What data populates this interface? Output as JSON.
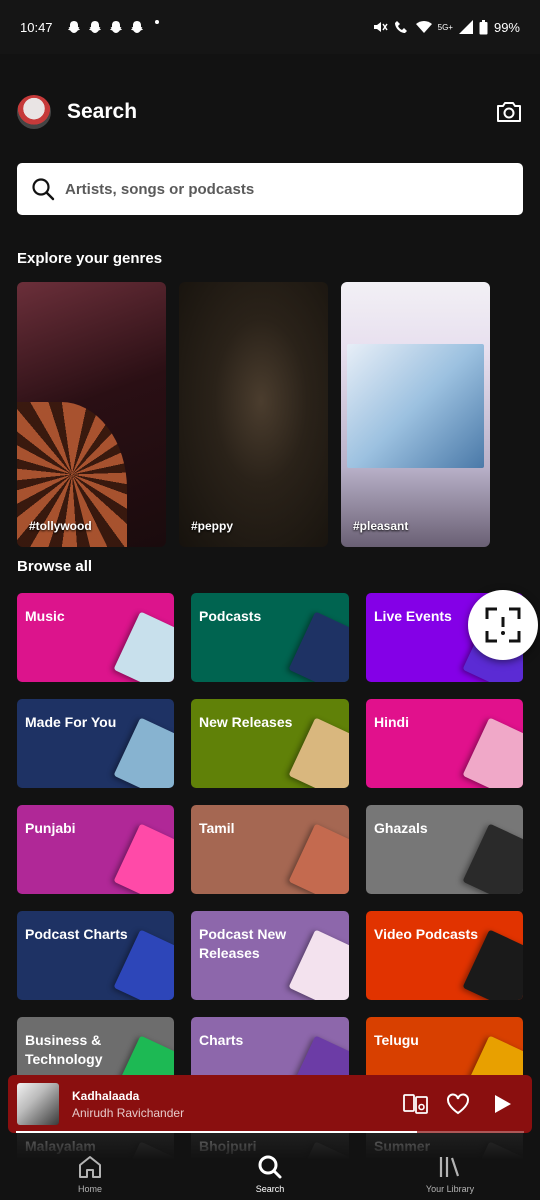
{
  "status_bar": {
    "time": "10:47",
    "network": "5G+",
    "battery": "99%",
    "notification_icons": [
      "snapchat-icon",
      "snapchat-icon",
      "snapchat-icon",
      "snapchat-icon"
    ]
  },
  "header": {
    "title": "Search"
  },
  "search": {
    "placeholder": "Artists, songs or podcasts"
  },
  "genres": {
    "title": "Explore your genres",
    "items": [
      {
        "label": "#tollywood"
      },
      {
        "label": "#peppy"
      },
      {
        "label": "#pleasant"
      }
    ]
  },
  "browse": {
    "title": "Browse all",
    "tiles": [
      {
        "label": "Music",
        "color": "#dc148c",
        "art": "#c8e0ec"
      },
      {
        "label": "Podcasts",
        "color": "#006450",
        "art": "#1e3264"
      },
      {
        "label": "Live Events",
        "color": "#8400e7",
        "art": "#5b2bd4"
      },
      {
        "label": "Made For You",
        "color": "#1e3264",
        "art": "#87b3d0"
      },
      {
        "label": "New Releases",
        "color": "#608108",
        "art": "#d9b77e"
      },
      {
        "label": "Hindi",
        "color": "#e1118c",
        "art": "#f0a8c8"
      },
      {
        "label": "Punjabi",
        "color": "#b02897",
        "art": "#ff4aa8"
      },
      {
        "label": "Tamil",
        "color": "#a56752",
        "art": "#c46a4f"
      },
      {
        "label": "Ghazals",
        "color": "#777777",
        "art": "#2a2a2a"
      },
      {
        "label": "Podcast Charts",
        "color": "#1e3264",
        "art": "#2d46b9"
      },
      {
        "label": "Podcast New Releases",
        "color": "#8d67ab",
        "art": "#f3e2ee"
      },
      {
        "label": "Video Podcasts",
        "color": "#e13300",
        "art": "#1a1a1a"
      },
      {
        "label": "Business & Technology",
        "color": "#6d6d6d",
        "art": "#1db954"
      },
      {
        "label": "Charts",
        "color": "#8d67ab",
        "art": "#6c3ca6"
      },
      {
        "label": "Telugu",
        "color": "#d84000",
        "art": "#e8a000"
      },
      {
        "label": "Malayalam",
        "color": "#333333",
        "art": "#555555"
      },
      {
        "label": "Bhojpuri",
        "color": "#333333",
        "art": "#555555"
      },
      {
        "label": "Summer",
        "color": "#333333",
        "art": "#555555"
      }
    ]
  },
  "now_playing": {
    "title": "Kadhalaada",
    "artist": "Anirudh Ravichander",
    "progress": 0.79
  },
  "nav": {
    "items": [
      {
        "label": "Home"
      },
      {
        "label": "Search"
      },
      {
        "label": "Your Library"
      }
    ],
    "active": "Search"
  }
}
